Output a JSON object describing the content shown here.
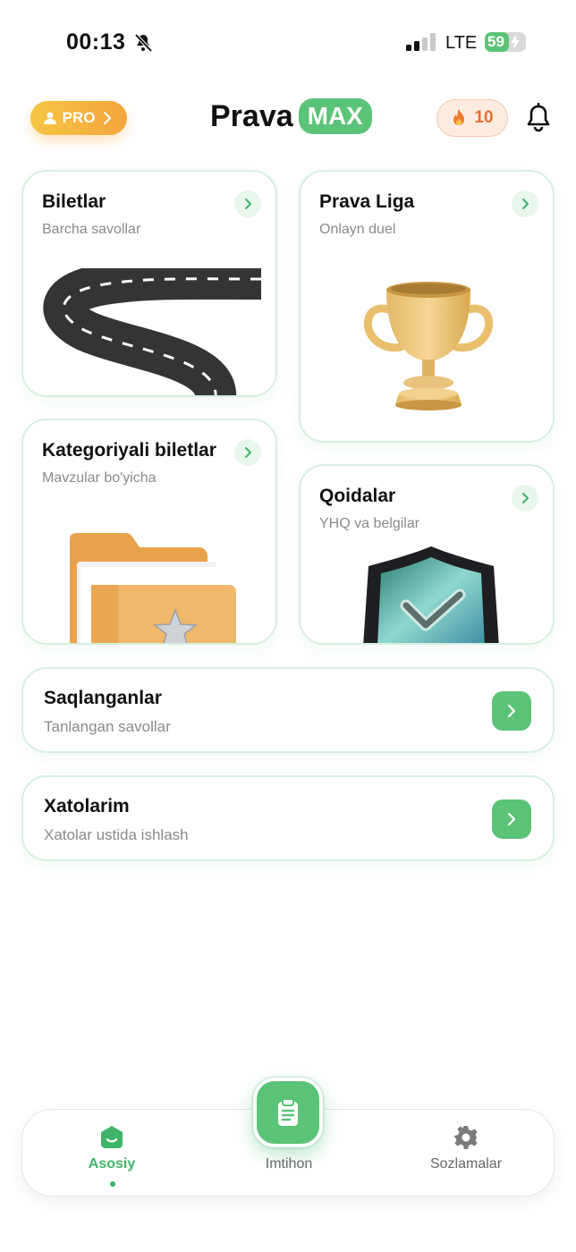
{
  "status_bar": {
    "time": "00:13",
    "network": "LTE",
    "battery": "59",
    "battery_level_percent": 59
  },
  "header": {
    "pro_label": "PRO",
    "brand_part1": "Prava",
    "brand_part2": "MAX",
    "streak_count": "10"
  },
  "cards": {
    "biletlar": {
      "title": "Biletlar",
      "subtitle": "Barcha savollar"
    },
    "liga": {
      "title": "Prava Liga",
      "subtitle": "Onlayn duel"
    },
    "kategoriya": {
      "title": "Kategoriyali biletlar",
      "subtitle": "Mavzular bo'yicha"
    },
    "qoidalar": {
      "title": "Qoidalar",
      "subtitle": "YHQ va belgilar"
    }
  },
  "rows": {
    "saved": {
      "title": "Saqlanganlar",
      "subtitle": "Tanlangan savollar"
    },
    "mistakes": {
      "title": "Xatolarim",
      "subtitle": "Xatolar ustida ishlash"
    }
  },
  "bottom_nav": {
    "home": "Asosiy",
    "exam": "Imtihon",
    "settings": "Sozlamalar",
    "active": "home"
  },
  "colors": {
    "accent_green": "#5bc377",
    "pro_orange": "#f4a53c",
    "streak_orange": "#ec6d2d",
    "card_border": "#d6efdf"
  },
  "icons": [
    "bell-off-icon",
    "signal-icon",
    "battery-icon",
    "user-icon",
    "fire-icon",
    "bell-icon",
    "chevron-right-icon",
    "road-image",
    "trophy-image",
    "folder-star-image",
    "shield-check-image",
    "home-icon",
    "clipboard-icon",
    "gear-icon"
  ]
}
